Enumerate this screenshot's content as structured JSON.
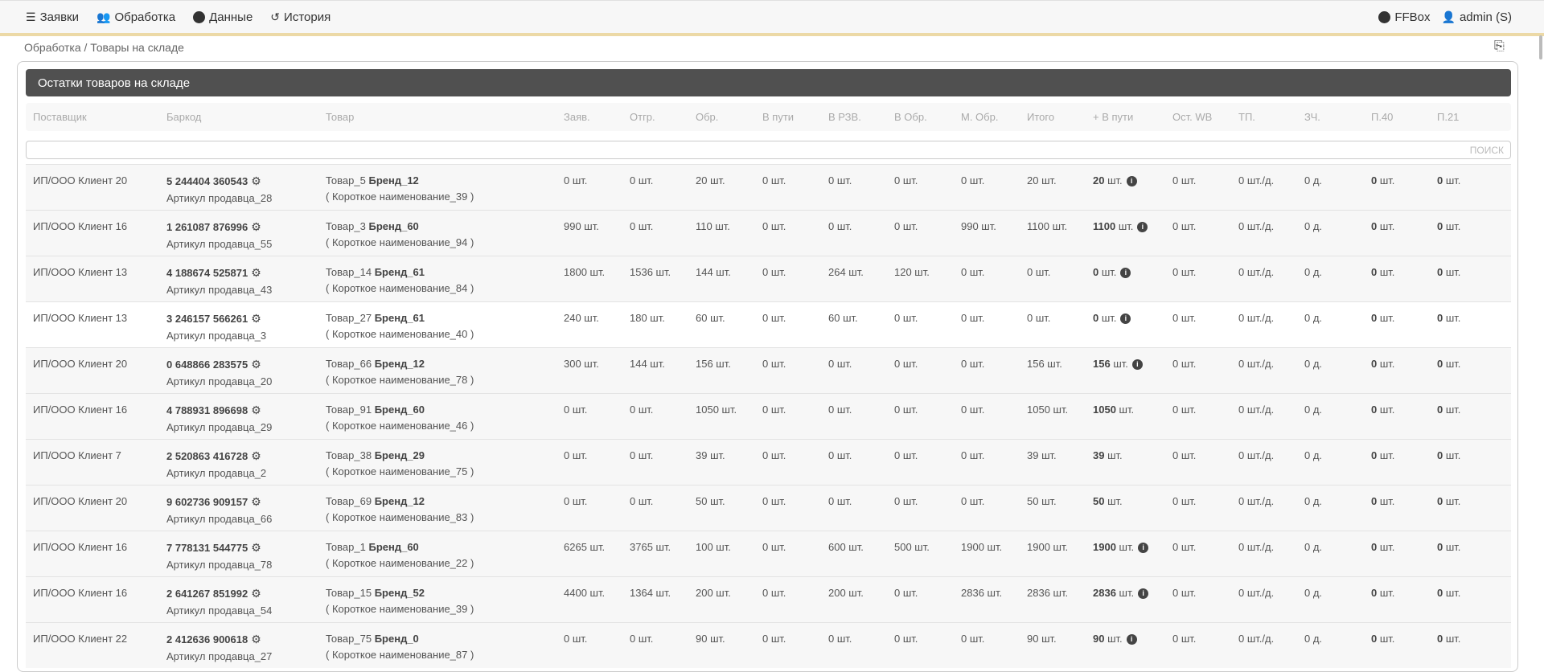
{
  "nav": {
    "items": [
      {
        "icon": "menu-icon",
        "label": "Заявки"
      },
      {
        "icon": "users-icon",
        "label": "Обработка"
      },
      {
        "icon": "info-icon",
        "label": "Данные"
      },
      {
        "icon": "history-icon",
        "label": "История"
      }
    ],
    "brand": "FFBox",
    "user": "admin (S)"
  },
  "breadcrumb": "Обработка / Товары на складе",
  "card": {
    "title": "Остатки товаров на складе",
    "search_placeholder": "ПОИСК"
  },
  "columns": [
    "Поставщик",
    "Баркод",
    "Товар",
    "Заяв.",
    "Отгр.",
    "Обр.",
    "В пути",
    "В РЗВ.",
    "В Обр.",
    "М. Обр.",
    "Итого",
    "+ В пути",
    "Ост. WB",
    "ТП.",
    "ЗЧ.",
    "П.40",
    "П.21"
  ],
  "rows": [
    {
      "supplier": "ИП/ООО Клиент 20",
      "barcode": "5 244404 360543",
      "article": "Артикул продавца_28",
      "product": "Товар_5",
      "brand": "Бренд_12",
      "short": "( Короткое наименование_39 )",
      "vals": [
        "0 шт.",
        "0 шт.",
        "20 шт.",
        "0 шт.",
        "0 шт.",
        "0 шт.",
        "0 шт.",
        "20 шт."
      ],
      "plus": "20",
      "info": true,
      "wb": "0 шт.",
      "tp": "0 шт./д.",
      "zch": "0 д.",
      "p40": "0",
      "p21": "0"
    },
    {
      "supplier": "ИП/ООО Клиент 16",
      "barcode": "1 261087 876996",
      "article": "Артикул продавца_55",
      "product": "Товар_3",
      "brand": "Бренд_60",
      "short": "( Короткое наименование_94 )",
      "vals": [
        "990 шт.",
        "0 шт.",
        "110 шт.",
        "0 шт.",
        "0 шт.",
        "0 шт.",
        "990 шт.",
        "1100 шт."
      ],
      "plus": "1100",
      "info": true,
      "wb": "0 шт.",
      "tp": "0 шт./д.",
      "zch": "0 д.",
      "p40": "0",
      "p21": "0"
    },
    {
      "supplier": "ИП/ООО Клиент 13",
      "barcode": "4 188674 525871",
      "article": "Артикул продавца_43",
      "product": "Товар_14",
      "brand": "Бренд_61",
      "short": "( Короткое наименование_84 )",
      "vals": [
        "1800 шт.",
        "1536 шт.",
        "144 шт.",
        "0 шт.",
        "264 шт.",
        "120 шт.",
        "0 шт.",
        "0 шт."
      ],
      "plus": "0",
      "info": true,
      "wb": "0 шт.",
      "tp": "0 шт./д.",
      "zch": "0 д.",
      "p40": "0",
      "p21": "0"
    },
    {
      "supplier": "ИП/ООО Клиент 13",
      "barcode": "3 246157 566261",
      "article": "Артикул продавца_3",
      "product": "Товар_27",
      "brand": "Бренд_61",
      "short": "( Короткое наименование_40 )",
      "vals": [
        "240 шт.",
        "180 шт.",
        "60 шт.",
        "0 шт.",
        "60 шт.",
        "0 шт.",
        "0 шт.",
        "0 шт."
      ],
      "plus": "0",
      "info": true,
      "wb": "0 шт.",
      "tp": "0 шт./д.",
      "zch": "0 д.",
      "p40": "0",
      "p21": "0"
    },
    {
      "supplier": "ИП/ООО Клиент 20",
      "barcode": "0 648866 283575",
      "article": "Артикул продавца_20",
      "product": "Товар_66",
      "brand": "Бренд_12",
      "short": "( Короткое наименование_78 )",
      "vals": [
        "300 шт.",
        "144 шт.",
        "156 шт.",
        "0 шт.",
        "0 шт.",
        "0 шт.",
        "0 шт.",
        "156 шт."
      ],
      "plus": "156",
      "info": true,
      "wb": "0 шт.",
      "tp": "0 шт./д.",
      "zch": "0 д.",
      "p40": "0",
      "p21": "0"
    },
    {
      "supplier": "ИП/ООО Клиент 16",
      "barcode": "4 788931 896698",
      "article": "Артикул продавца_29",
      "product": "Товар_91",
      "brand": "Бренд_60",
      "short": "( Короткое наименование_46 )",
      "vals": [
        "0 шт.",
        "0 шт.",
        "1050 шт.",
        "0 шт.",
        "0 шт.",
        "0 шт.",
        "0 шт.",
        "1050 шт."
      ],
      "plus": "1050",
      "info": false,
      "wb": "0 шт.",
      "tp": "0 шт./д.",
      "zch": "0 д.",
      "p40": "0",
      "p21": "0"
    },
    {
      "supplier": "ИП/ООО Клиент 7",
      "barcode": "2 520863 416728",
      "article": "Артикул продавца_2",
      "product": "Товар_38",
      "brand": "Бренд_29",
      "short": "( Короткое наименование_75 )",
      "vals": [
        "0 шт.",
        "0 шт.",
        "39 шт.",
        "0 шт.",
        "0 шт.",
        "0 шт.",
        "0 шт.",
        "39 шт."
      ],
      "plus": "39",
      "info": false,
      "wb": "0 шт.",
      "tp": "0 шт./д.",
      "zch": "0 д.",
      "p40": "0",
      "p21": "0"
    },
    {
      "supplier": "ИП/ООО Клиент 20",
      "barcode": "9 602736 909157",
      "article": "Артикул продавца_66",
      "product": "Товар_69",
      "brand": "Бренд_12",
      "short": "( Короткое наименование_83 )",
      "vals": [
        "0 шт.",
        "0 шт.",
        "50 шт.",
        "0 шт.",
        "0 шт.",
        "0 шт.",
        "0 шт.",
        "50 шт."
      ],
      "plus": "50",
      "info": false,
      "wb": "0 шт.",
      "tp": "0 шт./д.",
      "zch": "0 д.",
      "p40": "0",
      "p21": "0"
    },
    {
      "supplier": "ИП/ООО Клиент 16",
      "barcode": "7 778131 544775",
      "article": "Артикул продавца_78",
      "product": "Товар_1",
      "brand": "Бренд_60",
      "short": "( Короткое наименование_22 )",
      "vals": [
        "6265 шт.",
        "3765 шт.",
        "100 шт.",
        "0 шт.",
        "600 шт.",
        "500 шт.",
        "1900 шт.",
        "1900 шт."
      ],
      "plus": "1900",
      "info": true,
      "wb": "0 шт.",
      "tp": "0 шт./д.",
      "zch": "0 д.",
      "p40": "0",
      "p21": "0"
    },
    {
      "supplier": "ИП/ООО Клиент 16",
      "barcode": "2 641267 851992",
      "article": "Артикул продавца_54",
      "product": "Товар_15",
      "brand": "Бренд_52",
      "short": "( Короткое наименование_39 )",
      "vals": [
        "4400 шт.",
        "1364 шт.",
        "200 шт.",
        "0 шт.",
        "200 шт.",
        "0 шт.",
        "2836 шт.",
        "2836 шт."
      ],
      "plus": "2836",
      "info": true,
      "wb": "0 шт.",
      "tp": "0 шт./д.",
      "zch": "0 д.",
      "p40": "0",
      "p21": "0"
    },
    {
      "supplier": "ИП/ООО Клиент 22",
      "barcode": "2 412636 900618",
      "article": "Артикул продавца_27",
      "product": "Товар_75",
      "brand": "Бренд_0",
      "short": "( Короткое наименование_87 )",
      "vals": [
        "0 шт.",
        "0 шт.",
        "90 шт.",
        "0 шт.",
        "0 шт.",
        "0 шт.",
        "0 шт.",
        "90 шт."
      ],
      "plus": "90",
      "info": true,
      "wb": "0 шт.",
      "tp": "0 шт./д.",
      "zch": "0 д.",
      "p40": "0",
      "p21": "0"
    }
  ],
  "unit": "шт."
}
